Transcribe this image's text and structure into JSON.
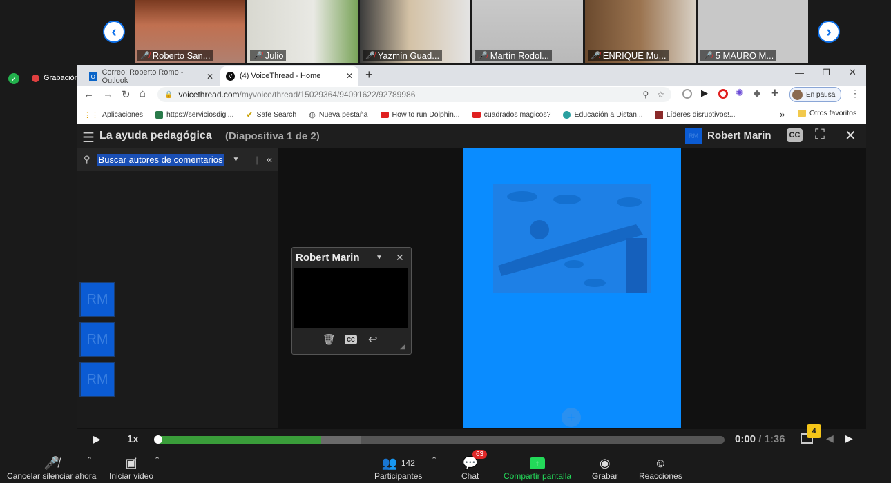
{
  "gallery": {
    "participants": [
      {
        "name": "Roberto San..."
      },
      {
        "name": "Julio"
      },
      {
        "name": "Yazmín Guad..."
      },
      {
        "name": "Martín Rodol..."
      },
      {
        "name": "ENRIQUE Mu..."
      },
      {
        "name": "5 MAURO M..."
      }
    ]
  },
  "recording": {
    "label": "Grabación"
  },
  "browser": {
    "tabs": [
      {
        "label": "Correo: Roberto Romo - Outlook"
      },
      {
        "label": "(4) VoiceThread - Home"
      }
    ],
    "new_tab": "+",
    "url_domain": "voicethread.com",
    "url_path": "/myvoice/thread/15029364/94091622/92789986",
    "profile_status": "En pausa",
    "bookmarks": [
      {
        "label": "Aplicaciones"
      },
      {
        "label": "https://serviciosdigi..."
      },
      {
        "label": "Safe Search"
      },
      {
        "label": "Nueva pestaña"
      },
      {
        "label": "How to run Dolphin..."
      },
      {
        "label": "cuadrados magicos?"
      },
      {
        "label": "Educación a Distan..."
      },
      {
        "label": "Líderes disruptivos!..."
      }
    ],
    "other_bookmarks": "Otros favoritos",
    "more_bookmarks": "»"
  },
  "voicethread": {
    "title": "La ayuda pedagógica",
    "slide_indicator": "(Diapositiva 1 de 2)",
    "user_name": "Robert Marin",
    "user_initials": "RM",
    "cc_label": "CC",
    "search_placeholder": "Buscar autores de comentarios",
    "comment_avatars": [
      "RM",
      "RM",
      "RM"
    ],
    "popup": {
      "author": "Robert Marin"
    },
    "playback_speed": "1x",
    "time_current": "0:00",
    "time_sep": "/",
    "time_total": "1:36",
    "comment_count": "4",
    "progress": 0.29,
    "buffered": 0.36
  },
  "zoom_toolbar": {
    "mute_label": "Cancelar silenciar ahora",
    "video_label": "Iniciar video",
    "participants_label": "Participantes",
    "participants_count": "142",
    "chat_label": "Chat",
    "chat_badge": "63",
    "share_label": "Compartir pantalla",
    "record_label": "Grabar",
    "reactions_label": "Reacciones"
  },
  "colors": {
    "share_green": "#23d959",
    "vt_blue": "#0a8cff",
    "progress_green": "#3a9d3a",
    "badge_red": "#e02828"
  }
}
